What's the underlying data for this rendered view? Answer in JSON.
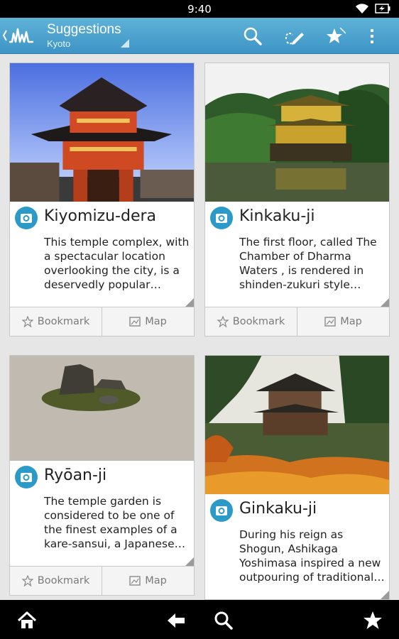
{
  "status_bar": {
    "time": "9:40"
  },
  "action_bar": {
    "title": "Suggestions",
    "subtitle": "Kyoto",
    "icons": [
      "up-icon",
      "app-logo-icon",
      "search-icon",
      "edit-icon",
      "favorites-icon",
      "overflow-menu-icon"
    ]
  },
  "cards": [
    {
      "title": "Kiyomizu-dera",
      "description": "This temple complex, with a spectacular location overlooking the city, is a deservedly popular…",
      "bookmark_label": "Bookmark",
      "map_label": "Map"
    },
    {
      "title": "Kinkaku-ji",
      "description": "The first floor, called The Chamber of Dharma Waters , is rendered in shinden-zukuri style…",
      "bookmark_label": "Bookmark",
      "map_label": "Map"
    },
    {
      "title": "Ryōan-ji",
      "description": "The temple garden is considered to be one of the finest examples of a kare-sansui, a Japanese…",
      "bookmark_label": "Bookmark",
      "map_label": "Map"
    },
    {
      "title": "Ginkaku-ji",
      "description": "During his reign as Shogun, Ashikaga Yoshimasa inspired a new outpouring of traditional…"
    }
  ],
  "nav_bar": {
    "icons": [
      "home-icon",
      "back-icon",
      "search-icon",
      "star-icon"
    ]
  },
  "colors": {
    "action_bar": "#4ba3d0",
    "accent": "#2b9ac9",
    "background": "#e6e6e6"
  }
}
